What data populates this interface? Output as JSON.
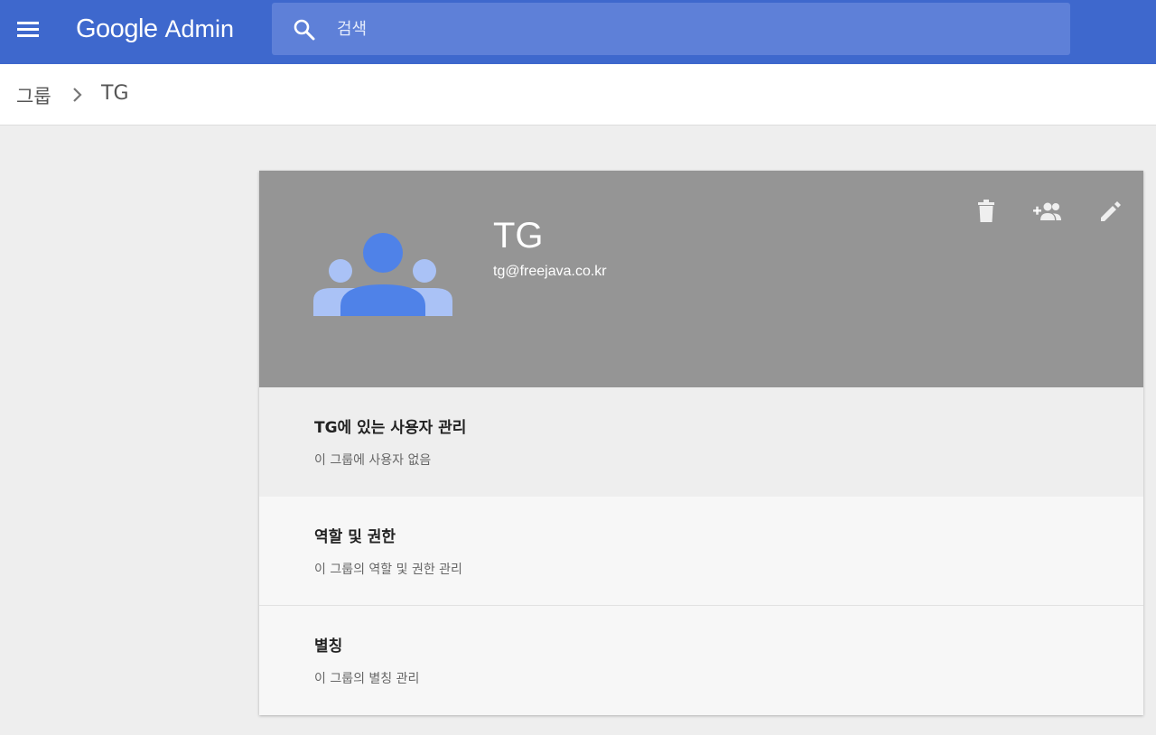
{
  "app": {
    "brand_google": "Google",
    "brand_admin": "Admin",
    "accent_color": "#3e68cd"
  },
  "search": {
    "placeholder": "검색",
    "value": ""
  },
  "breadcrumb": {
    "root": "그룹",
    "current": "TG"
  },
  "group": {
    "name": "TG",
    "email": "tg@freejava.co.kr",
    "header_color": "#959595",
    "actions": [
      "delete-icon",
      "add-member-icon",
      "edit-icon"
    ]
  },
  "sections": [
    {
      "title": "TG에 있는 사용자 관리",
      "desc": "이 그룹에 사용자 없음"
    },
    {
      "title": "역할 및 권한",
      "desc": "이 그룹의 역할 및 권한 관리"
    },
    {
      "title": "별칭",
      "desc": "이 그룹의 별칭 관리"
    }
  ]
}
